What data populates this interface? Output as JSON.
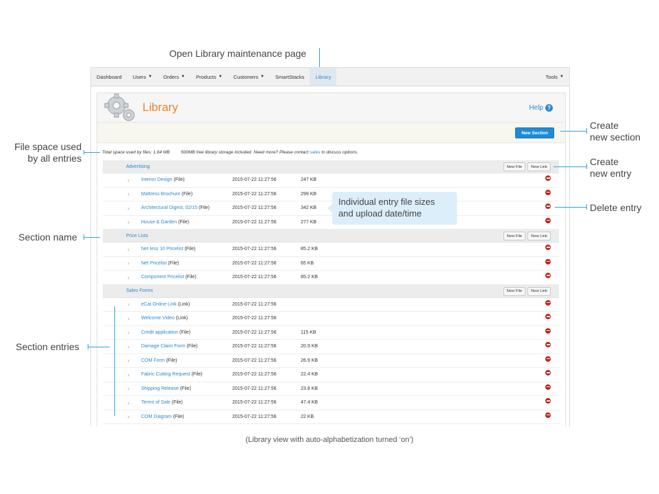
{
  "annotations": {
    "open_library": "Open Library maintenance page",
    "file_space": [
      "File space used",
      "by all entries"
    ],
    "section_name": "Section name",
    "section_entries": "Section entries",
    "create_section": [
      "Create",
      "new section"
    ],
    "create_entry": [
      "Create",
      "new entry"
    ],
    "delete_entry": "Delete entry",
    "tooltip": [
      "Individual entry file sizes",
      "and upload date/time"
    ],
    "caption": "(Library view with auto-alphabetization turned ‘on’)"
  },
  "nav": {
    "items": [
      {
        "label": "Dashboard",
        "caret": false
      },
      {
        "label": "Users",
        "caret": true
      },
      {
        "label": "Orders",
        "caret": true
      },
      {
        "label": "Products",
        "caret": true
      },
      {
        "label": "Customers",
        "caret": true
      },
      {
        "label": "SmartStacks",
        "caret": false
      },
      {
        "label": "Library",
        "caret": false,
        "active": true
      }
    ],
    "tools": "Tools"
  },
  "page": {
    "title": "Library",
    "help": "Help",
    "new_section": "New Section",
    "space_used": "Total space used by files: 1.64 MB",
    "storage_note_pre": "500MB free library storage included. Need more? Please contact ",
    "storage_link": "sales",
    "storage_note_post": " to discuss options."
  },
  "section_buttons": {
    "new_file": "New File",
    "new_link": "New Link"
  },
  "sections": [
    {
      "name": "Advertising",
      "entries": [
        {
          "name": "Interior Design",
          "type": "(File)",
          "date": "2015-07-22 11:27:56",
          "size": "247 KB"
        },
        {
          "name": "Mattress Brochure",
          "type": "(File)",
          "date": "2015-07-22 11:27:56",
          "size": "299 KB"
        },
        {
          "name": "Architectural Digest, 02/15",
          "type": "(File)",
          "date": "2015-07-22 11:27:56",
          "size": "342 KB"
        },
        {
          "name": "House & Garden",
          "type": "(File)",
          "date": "2015-07-22 11:27:56",
          "size": "277 KB"
        }
      ]
    },
    {
      "name": "Price Lists",
      "entries": [
        {
          "name": "Net less 10 Pricelist",
          "type": "(File)",
          "date": "2015-07-22 11:27:56",
          "size": "85.2 KB"
        },
        {
          "name": "Net Pricelist",
          "type": "(File)",
          "date": "2015-07-22 11:27:56",
          "size": "65 KB"
        },
        {
          "name": "Component Pricelist",
          "type": "(File)",
          "date": "2015-07-22 11:27:56",
          "size": "85.2 KB"
        }
      ]
    },
    {
      "name": "Sales Forms",
      "entries": [
        {
          "name": "eCat Online Link",
          "type": "(Link)",
          "date": "2015-07-22 11:27:56",
          "size": ""
        },
        {
          "name": "Welcome Video",
          "type": "(Link)",
          "date": "2015-07-22 11:27:56",
          "size": ""
        },
        {
          "name": "Credit application",
          "type": "(File)",
          "date": "2015-07-22 11:27:56",
          "size": "115 KB"
        },
        {
          "name": "Damage Claim Form",
          "type": "(File)",
          "date": "2015-07-22 11:27:56",
          "size": "20.9 KB"
        },
        {
          "name": "COM Form",
          "type": "(File)",
          "date": "2015-07-22 11:27:56",
          "size": "26.9 KB"
        },
        {
          "name": "Fabric Cutting Request",
          "type": "(File)",
          "date": "2015-07-22 11:27:56",
          "size": "22.4 KB"
        },
        {
          "name": "Shipping Release",
          "type": "(File)",
          "date": "2015-07-22 11:27:56",
          "size": "23.8 KB"
        },
        {
          "name": "Terms of Sale",
          "type": "(File)",
          "date": "2015-07-22 11:27:56",
          "size": "47.4 KB"
        },
        {
          "name": "COM Diagram",
          "type": "(File)",
          "date": "2015-07-22 11:27:56",
          "size": "22 KB"
        }
      ]
    }
  ],
  "colors": {
    "accent": "#2b8ad0",
    "title": "#e8842a",
    "delete": "#c9221b",
    "callout": "#2aa6d8"
  }
}
